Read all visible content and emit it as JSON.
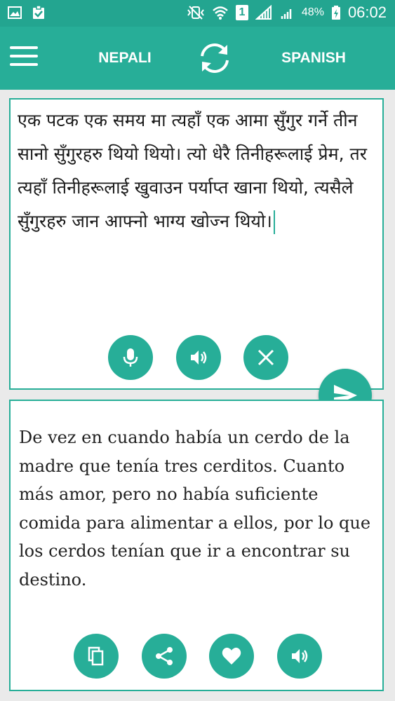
{
  "status_bar": {
    "battery_percent": "48%",
    "time": "06:02",
    "sim_slot": "1"
  },
  "app_bar": {
    "source_language": "NEPALI",
    "target_language": "SPANISH"
  },
  "source": {
    "text": "एक पटक एक समय मा त्यहाँ एक आमा सुँगुर गर्ने तीन सानो सुँगुरहरु थियो थियो। त्यो धेरै तिनीहरूलाई प्रेम, तर त्यहाँ तिनीहरूलाई खुवाउन पर्याप्त खाना थियो, त्यसैले सुँगुरहरु जान आफ्नो भाग्य खोज्न थियो।"
  },
  "target": {
    "text": "De vez en cuando había un cerdo de la madre que tenía tres cerditos. Cuanto más amor, pero no había suficiente comida para alimentar a ellos, por lo que los cerdos tenían que ir a encontrar su destino."
  },
  "icons": {
    "menu": "hamburger-menu-icon",
    "swap": "swap-arrows-icon",
    "mic": "microphone-icon",
    "speak": "speaker-icon",
    "clear": "close-icon",
    "send": "send-icon",
    "copy": "copy-icon",
    "share": "share-icon",
    "favorite": "heart-icon"
  },
  "colors": {
    "accent": "#27ae98",
    "status_bar": "#23a590",
    "background": "#eaeaea"
  }
}
